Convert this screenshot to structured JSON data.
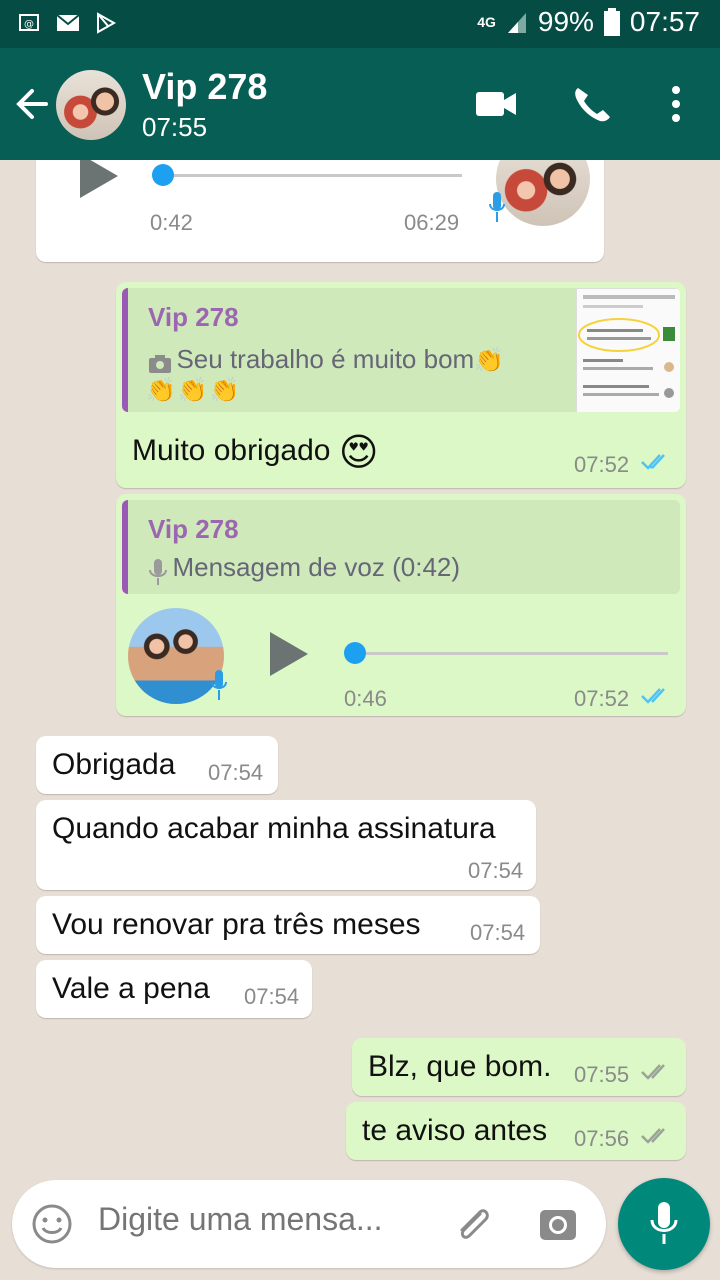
{
  "status_bar": {
    "network": "4G",
    "battery": "99%",
    "clock": "07:57"
  },
  "header": {
    "title": "Vip 278",
    "subtitle": "07:55"
  },
  "messages": {
    "voice_top": {
      "elapsed": "0:42",
      "time": "06:29",
      "progress": 0.0
    },
    "reply_image": {
      "quote_name": "Vip 278",
      "quote_text": "Seu trabalho é muito bom",
      "quote_emojis": "👏👏👏👏",
      "text": "Muito obrigado",
      "emoji": "😍",
      "time": "07:52"
    },
    "reply_voice": {
      "quote_name": "Vip 278",
      "quote_text": "Mensagem de voz (0:42)",
      "elapsed": "0:46",
      "time": "07:52",
      "progress": 0.0
    },
    "incoming": [
      {
        "text": "Obrigada",
        "time": "07:54"
      },
      {
        "text": "Quando acabar minha assinatura",
        "time": "07:54"
      },
      {
        "text": "Vou renovar pra três meses",
        "time": "07:54"
      },
      {
        "text": "Vale a pena",
        "time": "07:54"
      }
    ],
    "outgoing": [
      {
        "text": "Blz, que bom.",
        "time": "07:55"
      },
      {
        "text": "te aviso antes",
        "time": "07:56"
      }
    ]
  },
  "composer": {
    "placeholder": "Digite uma mensa..."
  },
  "colors": {
    "header": "#075e54",
    "status": "#054d44",
    "outgoing": "#dcf8c6",
    "incoming": "#ffffff",
    "fab": "#00897b",
    "read_tick": "#4fc3f7"
  },
  "icons": [
    "gmail-icon",
    "mail-icon",
    "play-store-icon",
    "signal-icon",
    "battery-icon",
    "back-arrow-icon",
    "video-call-icon",
    "phone-icon",
    "more-icon",
    "camera-icon",
    "mic-icon",
    "emoji-icon",
    "attach-icon"
  ]
}
